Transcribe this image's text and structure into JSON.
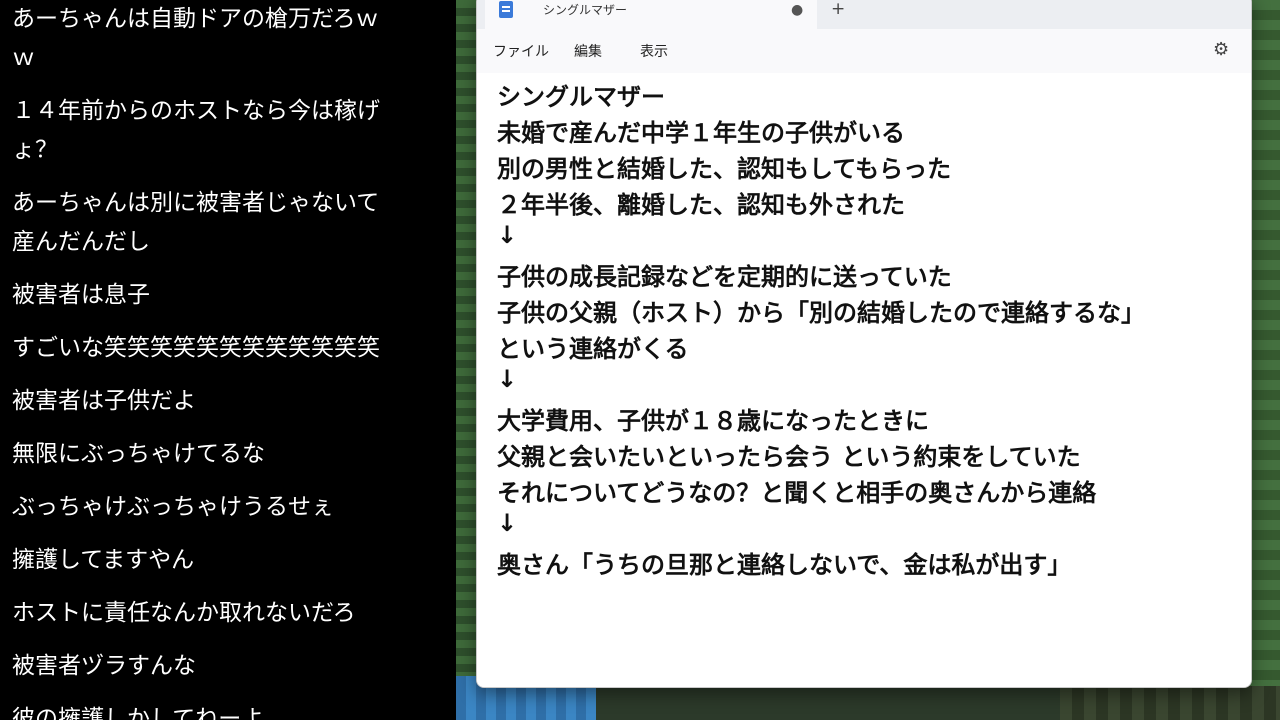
{
  "comments": [
    [
      "あーちゃんは自動ドアの槍万だろｗ",
      "ｗ"
    ],
    [
      "１４年前からのホストなら今は稼げ",
      "ょ？"
    ],
    [
      "あーちゃんは別に被害者じゃないて",
      "産んだんだし"
    ],
    [
      "被害者は息子"
    ],
    [
      "すごいな笑笑笑笑笑笑笑笑笑笑笑笑"
    ],
    [
      "被害者は子供だよ"
    ],
    [
      "無限にぶっちゃけてるな"
    ],
    [
      "ぶっちゃけぶっちゃけうるせぇ"
    ],
    [
      "擁護してますやん"
    ],
    [
      "ホストに責任なんか取れないだろ"
    ],
    [
      "被害者ヅラすんな"
    ],
    [
      "彼の擁護しかしてねーよ"
    ]
  ],
  "notepad": {
    "tab_title": "シングルマザー",
    "tab_dirty_marker": "●",
    "new_tab_label": "+",
    "menu": [
      "ファイル",
      "編集",
      "表示"
    ],
    "settings_icon": "gear-icon",
    "lines": [
      "シングルマザー",
      "未婚で産んだ中学１年生の子供がいる",
      "別の男性と結婚した、認知もしてもらった",
      "２年半後、離婚した、認知も外された",
      "↓",
      "子供の成長記録などを定期的に送っていた",
      "子供の父親（ホスト）から「別の結婚したので連絡するな」",
      "という連絡がくる",
      "↓",
      "大学費用、子供が１８歳になったときに",
      "父親と会いたいといったら会う という約束をしていた",
      "それについてどうなの？と聞くと相手の奥さんから連絡",
      "↓",
      "奥さん「うちの旦那と連絡しないで、金は私が出す」"
    ]
  }
}
